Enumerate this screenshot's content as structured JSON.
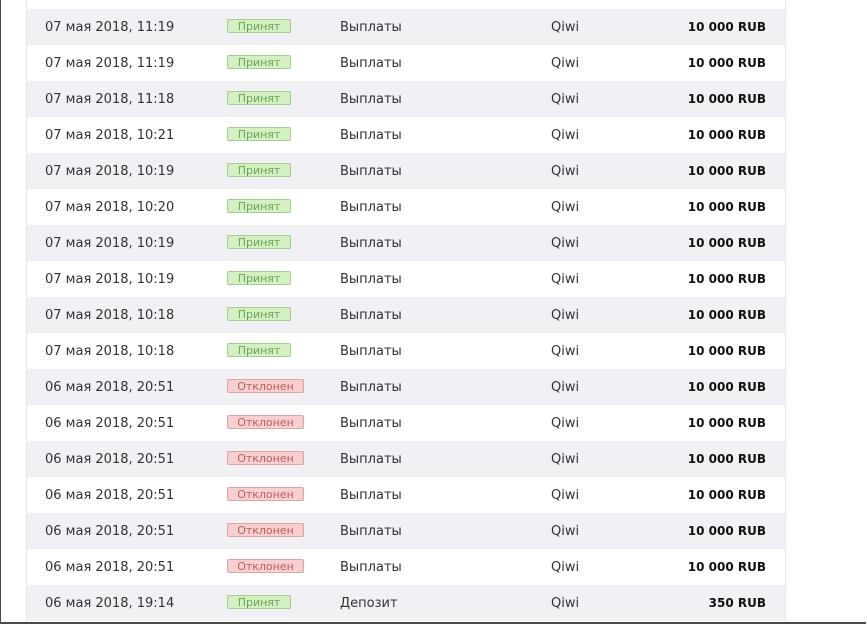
{
  "colors": {
    "accepted_bg": "#d4efc4",
    "accepted_text": "#6aa84f",
    "rejected_bg": "#f5d0d0",
    "rejected_text": "#c45b5b",
    "row_alt_bg": "#f0f0f5"
  },
  "transactions": [
    {
      "date": "07 мая 2018, 11:19",
      "status": "Принят",
      "status_kind": "accepted",
      "type": "Выплаты",
      "method": "Qiwi",
      "amount": "10 000 RUB"
    },
    {
      "date": "07 мая 2018, 11:19",
      "status": "Принят",
      "status_kind": "accepted",
      "type": "Выплаты",
      "method": "Qiwi",
      "amount": "10 000 RUB"
    },
    {
      "date": "07 мая 2018, 11:18",
      "status": "Принят",
      "status_kind": "accepted",
      "type": "Выплаты",
      "method": "Qiwi",
      "amount": "10 000 RUB"
    },
    {
      "date": "07 мая 2018, 10:21",
      "status": "Принят",
      "status_kind": "accepted",
      "type": "Выплаты",
      "method": "Qiwi",
      "amount": "10 000 RUB"
    },
    {
      "date": "07 мая 2018, 10:19",
      "status": "Принят",
      "status_kind": "accepted",
      "type": "Выплаты",
      "method": "Qiwi",
      "amount": "10 000 RUB"
    },
    {
      "date": "07 мая 2018, 10:20",
      "status": "Принят",
      "status_kind": "accepted",
      "type": "Выплаты",
      "method": "Qiwi",
      "amount": "10 000 RUB"
    },
    {
      "date": "07 мая 2018, 10:19",
      "status": "Принят",
      "status_kind": "accepted",
      "type": "Выплаты",
      "method": "Qiwi",
      "amount": "10 000 RUB"
    },
    {
      "date": "07 мая 2018, 10:19",
      "status": "Принят",
      "status_kind": "accepted",
      "type": "Выплаты",
      "method": "Qiwi",
      "amount": "10 000 RUB"
    },
    {
      "date": "07 мая 2018, 10:18",
      "status": "Принят",
      "status_kind": "accepted",
      "type": "Выплаты",
      "method": "Qiwi",
      "amount": "10 000 RUB"
    },
    {
      "date": "07 мая 2018, 10:18",
      "status": "Принят",
      "status_kind": "accepted",
      "type": "Выплаты",
      "method": "Qiwi",
      "amount": "10 000 RUB"
    },
    {
      "date": "06 мая 2018, 20:51",
      "status": "Отклонен",
      "status_kind": "rejected",
      "type": "Выплаты",
      "method": "Qiwi",
      "amount": "10 000 RUB"
    },
    {
      "date": "06 мая 2018, 20:51",
      "status": "Отклонен",
      "status_kind": "rejected",
      "type": "Выплаты",
      "method": "Qiwi",
      "amount": "10 000 RUB"
    },
    {
      "date": "06 мая 2018, 20:51",
      "status": "Отклонен",
      "status_kind": "rejected",
      "type": "Выплаты",
      "method": "Qiwi",
      "amount": "10 000 RUB"
    },
    {
      "date": "06 мая 2018, 20:51",
      "status": "Отклонен",
      "status_kind": "rejected",
      "type": "Выплаты",
      "method": "Qiwi",
      "amount": "10 000 RUB"
    },
    {
      "date": "06 мая 2018, 20:51",
      "status": "Отклонен",
      "status_kind": "rejected",
      "type": "Выплаты",
      "method": "Qiwi",
      "amount": "10 000 RUB"
    },
    {
      "date": "06 мая 2018, 20:51",
      "status": "Отклонен",
      "status_kind": "rejected",
      "type": "Выплаты",
      "method": "Qiwi",
      "amount": "10 000 RUB"
    },
    {
      "date": "06 мая 2018, 19:14",
      "status": "Принят",
      "status_kind": "accepted",
      "type": "Депозит",
      "method": "Qiwi",
      "amount": "350 RUB"
    }
  ]
}
